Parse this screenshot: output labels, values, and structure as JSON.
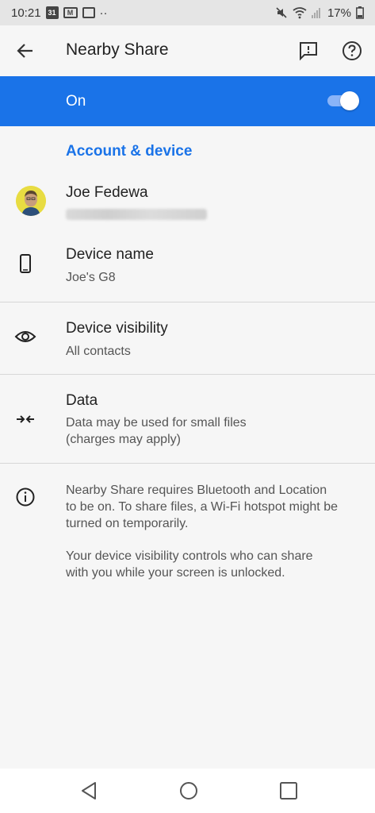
{
  "status_bar": {
    "time": "10:21",
    "calendar_badge": "31",
    "mail_badge": "M",
    "more": "··",
    "battery": "17%"
  },
  "app_bar": {
    "title": "Nearby Share",
    "back_icon": "arrow-back-icon",
    "feedback_icon": "feedback-icon",
    "help_icon": "help-icon"
  },
  "master_switch": {
    "label": "On",
    "enabled": true,
    "color": "#1a73e8"
  },
  "section": {
    "title": "Account & device"
  },
  "account": {
    "name": "Joe Fedewa",
    "email_hidden": true
  },
  "device_name": {
    "title": "Device name",
    "value": "Joe's G8",
    "icon": "phone-icon"
  },
  "device_visibility": {
    "title": "Device visibility",
    "value": "All contacts",
    "icon": "eye-icon"
  },
  "data_usage": {
    "title": "Data",
    "line1": "Data may be used for small files",
    "line2": "(charges may apply)",
    "icon": "compress-arrows-icon"
  },
  "info": {
    "icon": "info-icon",
    "paragraph1_line1": "Nearby Share requires Bluetooth and Location",
    "paragraph1_line2": "to be on. To share files, a Wi-Fi hotspot might be",
    "paragraph1_line3": "turned on temporarily.",
    "paragraph2_line1": "Your device visibility controls who can share",
    "paragraph2_line2": "with you while your screen is unlocked."
  },
  "nav_bar": {
    "back_icon": "nav-back-icon",
    "home_icon": "nav-home-icon",
    "recents_icon": "nav-recents-icon"
  }
}
